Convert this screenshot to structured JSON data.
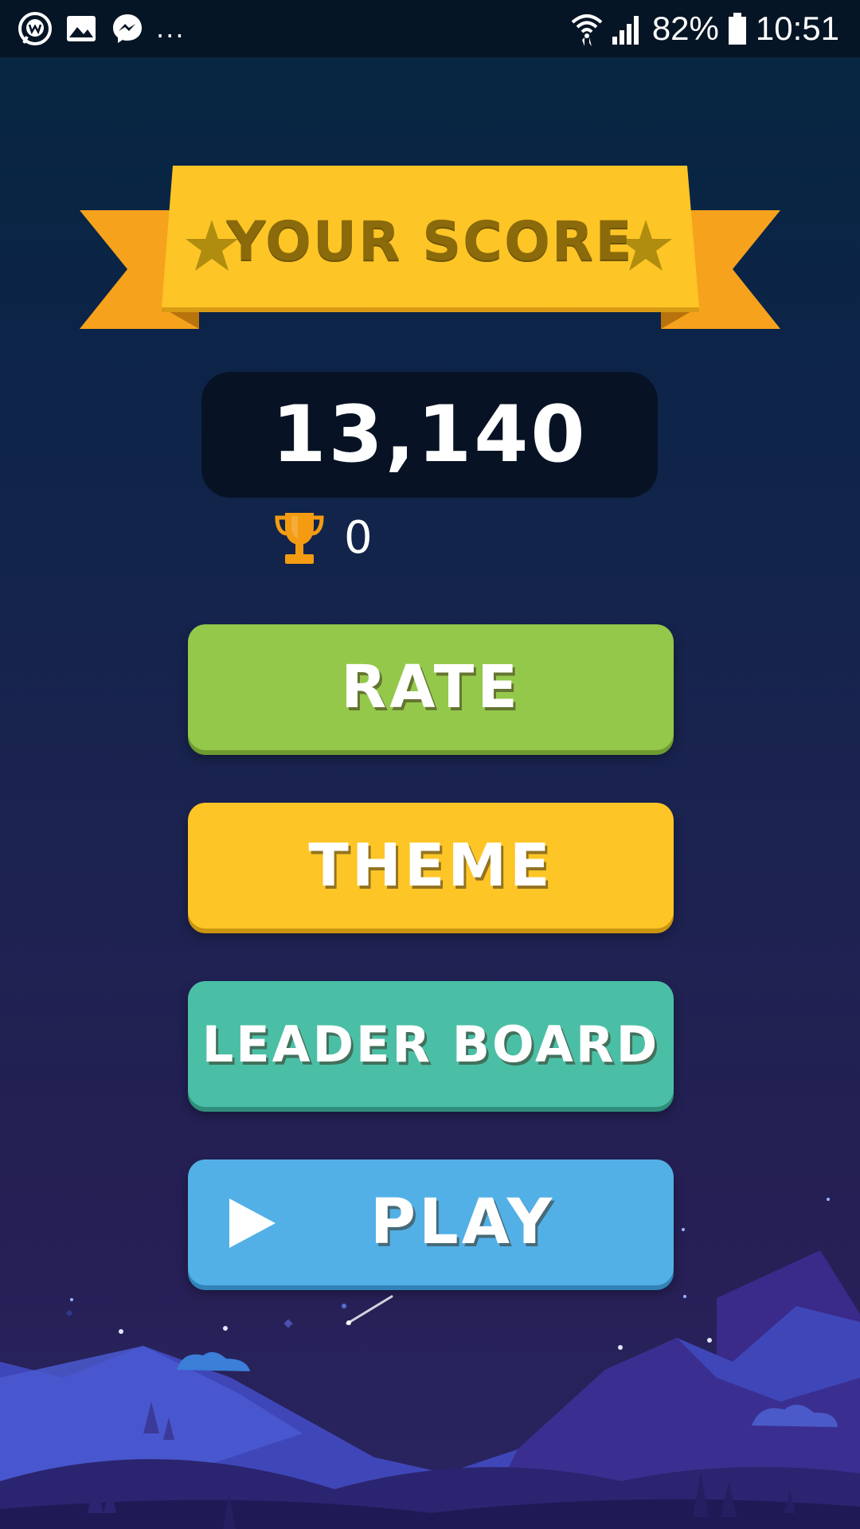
{
  "status_bar": {
    "icons_left": [
      "workplace-chat-icon",
      "gallery-icon",
      "messenger-icon"
    ],
    "overflow": "...",
    "battery": "82%",
    "time": "10:51",
    "icons_right": [
      "wifi-icon",
      "signal-icon",
      "battery-icon"
    ]
  },
  "score_panel": {
    "banner_title": "YOUR SCORE",
    "score": "13,140",
    "best_score": "0",
    "trophy_icon": "trophy-icon"
  },
  "menu": {
    "rate_label": "RATE",
    "theme_label": "THEME",
    "leaderboard_label": "LEADER BOARD",
    "play_label": "PLAY"
  },
  "colors": {
    "background_top": "#062640",
    "background_bottom": "#2a2560",
    "ribbon": "#fdc526",
    "ribbon_tails": "#f7a21d",
    "rate": "#94c84b",
    "theme": "#fdc526",
    "leaderboard": "#4bbfa6",
    "play": "#52b0e6"
  }
}
